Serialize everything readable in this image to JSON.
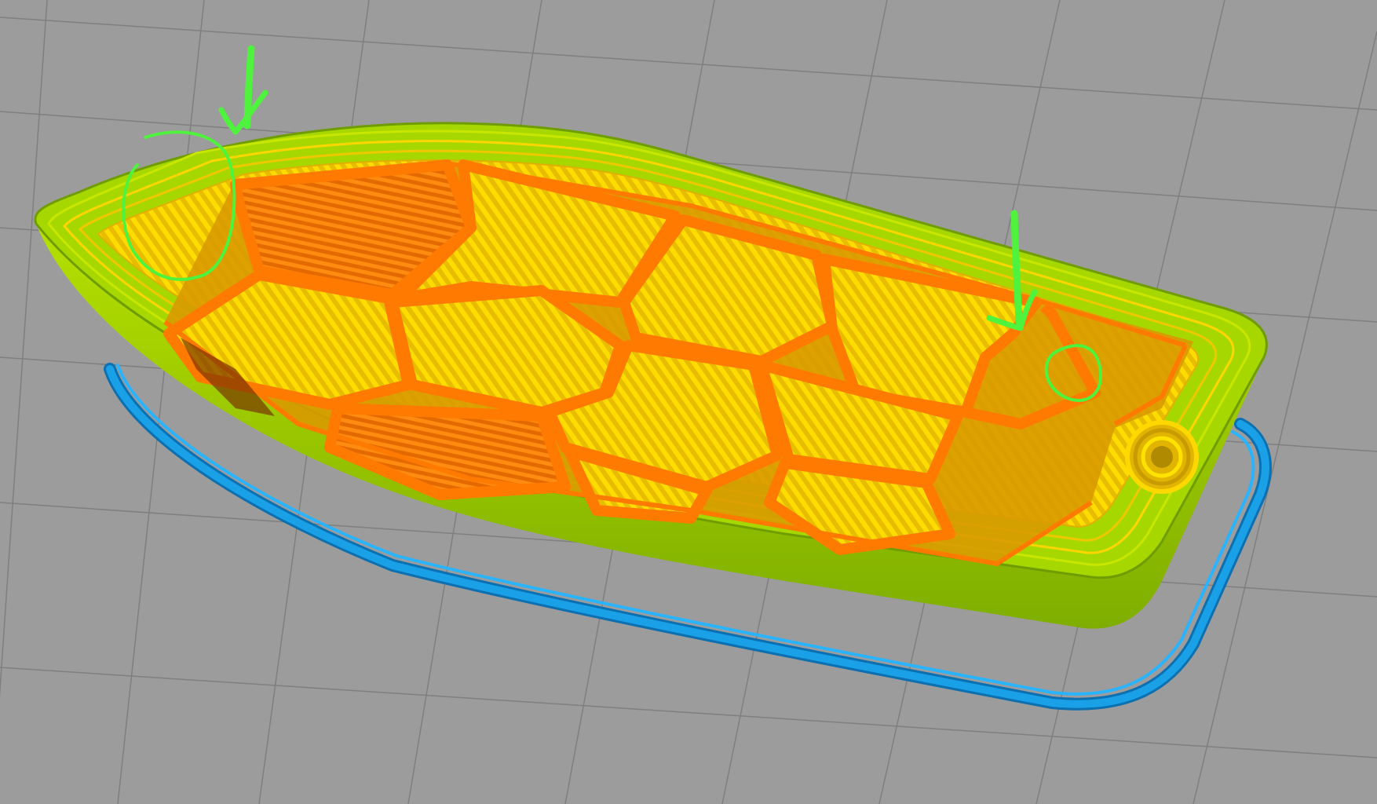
{
  "viewport": {
    "name": "slicer-gcode-preview",
    "colors": {
      "background": "#9c9c9c",
      "grid_line": "#7f7f7f",
      "skirt": "#1aa0e6",
      "skirt_dark": "#0b6fb0",
      "perimeter": "#9dd100",
      "perimeter_dark": "#6f9c00",
      "top_layer": "#e3c200",
      "top_layer_light": "#ffe200",
      "infill": "#ff7a00",
      "infill_dark": "#c85600",
      "annotation": "#4ff23c"
    }
  },
  "annotations": [
    {
      "kind": "arrow",
      "target": "bow-left-gap"
    },
    {
      "kind": "circle",
      "target": "bow-left-gap"
    },
    {
      "kind": "arrow",
      "target": "stern-right-gap"
    },
    {
      "kind": "circle",
      "target": "stern-right-gap"
    }
  ]
}
